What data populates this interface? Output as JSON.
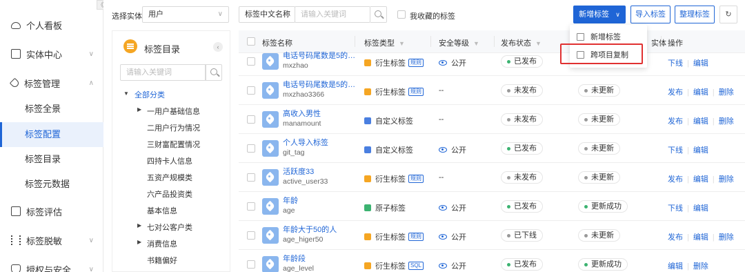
{
  "nav": {
    "collapse": "《",
    "items": [
      {
        "label": "个人看板",
        "icon": "cloud-icon"
      },
      {
        "label": "实体中心",
        "icon": "box-icon"
      },
      {
        "label": "标签管理",
        "icon": "tag-icon"
      },
      {
        "label": "标签评估",
        "icon": "evaluate-icon"
      },
      {
        "label": "标签脱敏",
        "icon": "desensitize-icon"
      },
      {
        "label": "授权与安全",
        "icon": "shield-icon"
      }
    ],
    "sub": [
      "标签全景",
      "标签配置",
      "标签目录",
      "标签元数据"
    ]
  },
  "filter": {
    "entity_label": "选择实体",
    "entity_value": "用户",
    "field_value": "标签中文名称",
    "keyword_placeholder": "请输入关键词",
    "fav_label": "我收藏的标签",
    "btn_add": "新增标签",
    "btn_import": "导入标签",
    "btn_organize": "整理标签"
  },
  "menu": {
    "items": [
      "新增标签",
      "跨项目复制"
    ]
  },
  "catalog": {
    "title": "标签目录",
    "collapse": "‹",
    "placeholder": "请输入关键词",
    "root": "全部分类",
    "nodes": [
      "一用户基础信息",
      "二用户行为情况",
      "三财富配置情况",
      "四持卡人信息",
      "五资产规模类",
      "六产品投资类",
      "基本信息",
      "七对公客户类",
      "消费信息",
      "书籍偏好"
    ]
  },
  "table": {
    "headers": [
      "标签名称",
      "标签类型",
      "安全等级",
      "发布状态",
      "实体",
      "操作"
    ],
    "rows": [
      {
        "name": "电话号码尾数是5的杭州...",
        "code": "mxzhao",
        "type": "衍生标签",
        "badge": "规则",
        "type_color": "#f5a623",
        "sec": "公开",
        "pub": "已发布",
        "upd": "",
        "actions": [
          "下线",
          "编辑"
        ]
      },
      {
        "name": "电话号码尾数是5的杭州...",
        "code": "mxzhao3366",
        "type": "衍生标签",
        "badge": "规则",
        "type_color": "#f5a623",
        "sec": "--",
        "pub": "未发布",
        "upd": "未更新",
        "actions": [
          "发布",
          "编辑",
          "删除"
        ]
      },
      {
        "name": "高收入男性",
        "code": "manamount",
        "type": "自定义标签",
        "badge": "",
        "type_color": "#4a7fe0",
        "sec": "--",
        "pub": "未发布",
        "upd": "未更新",
        "actions": [
          "发布",
          "编辑",
          "删除"
        ]
      },
      {
        "name": "个人导入标签",
        "code": "git_tag",
        "type": "自定义标签",
        "badge": "",
        "type_color": "#4a7fe0",
        "sec": "公开",
        "pub": "已发布",
        "upd": "未更新",
        "actions": [
          "下线",
          "编辑"
        ]
      },
      {
        "name": "活跃度33",
        "code": "active_user33",
        "type": "衍生标签",
        "badge": "规则",
        "type_color": "#f5a623",
        "sec": "--",
        "pub": "未发布",
        "upd": "未更新",
        "actions": [
          "发布",
          "编辑",
          "删除"
        ]
      },
      {
        "name": "年龄",
        "code": "age",
        "type": "原子标签",
        "badge": "",
        "type_color": "#3cb371",
        "sec": "公开",
        "pub": "已发布",
        "upd": "更新成功",
        "actions": [
          "下线",
          "编辑"
        ]
      },
      {
        "name": "年龄大于50的人",
        "code": "age_higer50",
        "type": "衍生标签",
        "badge": "规则",
        "type_color": "#f5a623",
        "sec": "公开",
        "pub": "已下线",
        "upd": "未更新",
        "actions": [
          "发布",
          "编辑",
          "删除"
        ]
      },
      {
        "name": "年龄段",
        "code": "age_level",
        "type": "衍生标签",
        "badge": "SQL",
        "type_color": "#f5a623",
        "sec": "公开",
        "pub": "已发布",
        "upd": "更新成功",
        "actions": [
          "编辑",
          "删除"
        ]
      }
    ]
  }
}
